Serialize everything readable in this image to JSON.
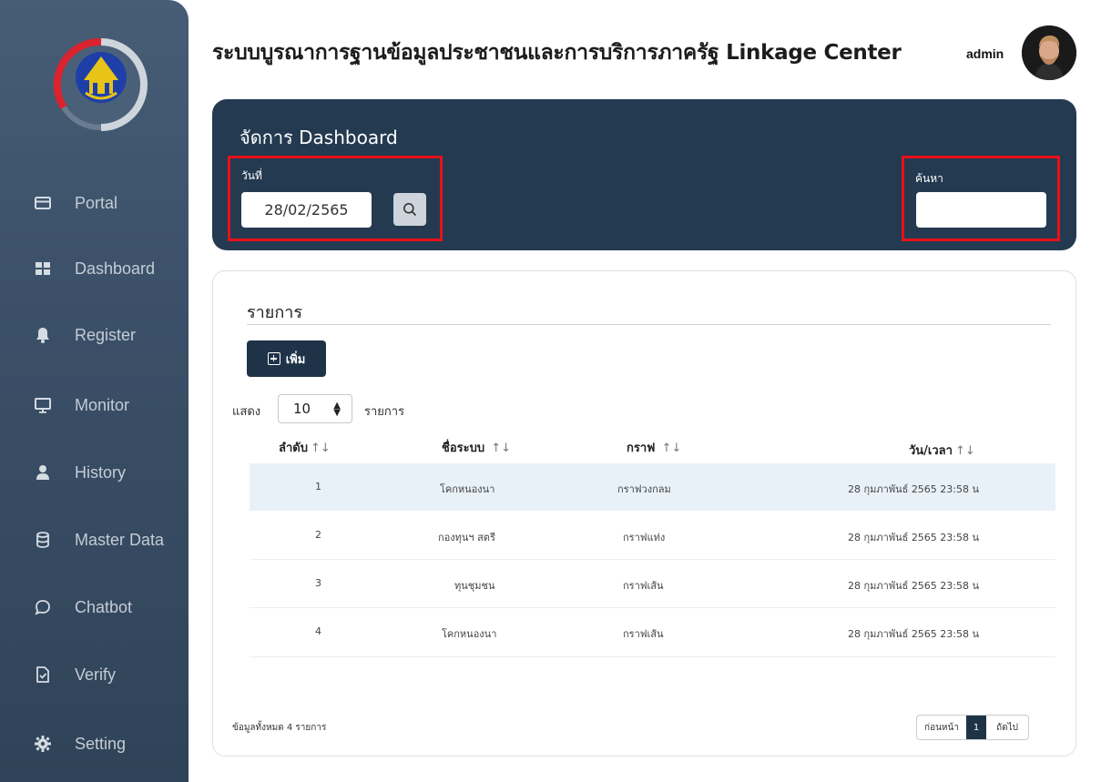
{
  "header": {
    "title": "ระบบบูรณาการฐานข้อมูลประชาชนและการบริการภาครัฐ  Linkage Center",
    "user": "admin"
  },
  "sidebar": {
    "items": [
      {
        "label": "Portal",
        "icon": "card-icon"
      },
      {
        "label": "Dashboard",
        "icon": "grid-icon"
      },
      {
        "label": "Register",
        "icon": "bell-icon"
      },
      {
        "label": "Monitor",
        "icon": "monitor-icon"
      },
      {
        "label": "History",
        "icon": "user-icon"
      },
      {
        "label": "Master Data",
        "icon": "database-icon"
      },
      {
        "label": "Chatbot",
        "icon": "chat-icon"
      },
      {
        "label": "Verify",
        "icon": "verify-icon"
      },
      {
        "label": "Setting",
        "icon": "gear-icon"
      }
    ]
  },
  "dashboard": {
    "title": "จัดการ Dashboard",
    "date_label": "วันที่",
    "date_value": "28/02/2565",
    "search_label": "ค้นหา",
    "search_value": ""
  },
  "list": {
    "title": "รายการ",
    "add_label": "เพิ่ม",
    "show_label": "แสดง",
    "page_size": "10",
    "show_suffix": "รายการ",
    "columns": [
      "ลำดับ",
      "ชื่อระบบ",
      "กราฟ",
      "วัน/เวลา"
    ],
    "rows": [
      {
        "no": "1",
        "system": "โคกหนองนา",
        "graph": "กราฟวงกลม",
        "datetime": "28 กุมภาพันธ์ 2565 23:58 น"
      },
      {
        "no": "2",
        "system": "กองทุนฯ สตรี",
        "graph": "กราฟแท่ง",
        "datetime": "28 กุมภาพันธ์ 2565 23:58 น"
      },
      {
        "no": "3",
        "system": "ทุนชุมชน",
        "graph": "กราฟเส้น",
        "datetime": "28 กุมภาพันธ์ 2565 23:58 น"
      },
      {
        "no": "4",
        "system": "โคกหนองนา",
        "graph": "กราฟเส้น",
        "datetime": "28 กุมภาพันธ์ 2565 23:58 น"
      }
    ],
    "total_text": "ข้อมูลทั้งหมด 4 รายการ",
    "pager": {
      "prev": "ก่อนหน้า",
      "current": "1",
      "next": "ถัดไป"
    }
  },
  "colors": {
    "sidebar": "#3b5068",
    "panel": "#243a50",
    "highlight": "#e8101a",
    "row_alt": "#e9f1f8"
  }
}
